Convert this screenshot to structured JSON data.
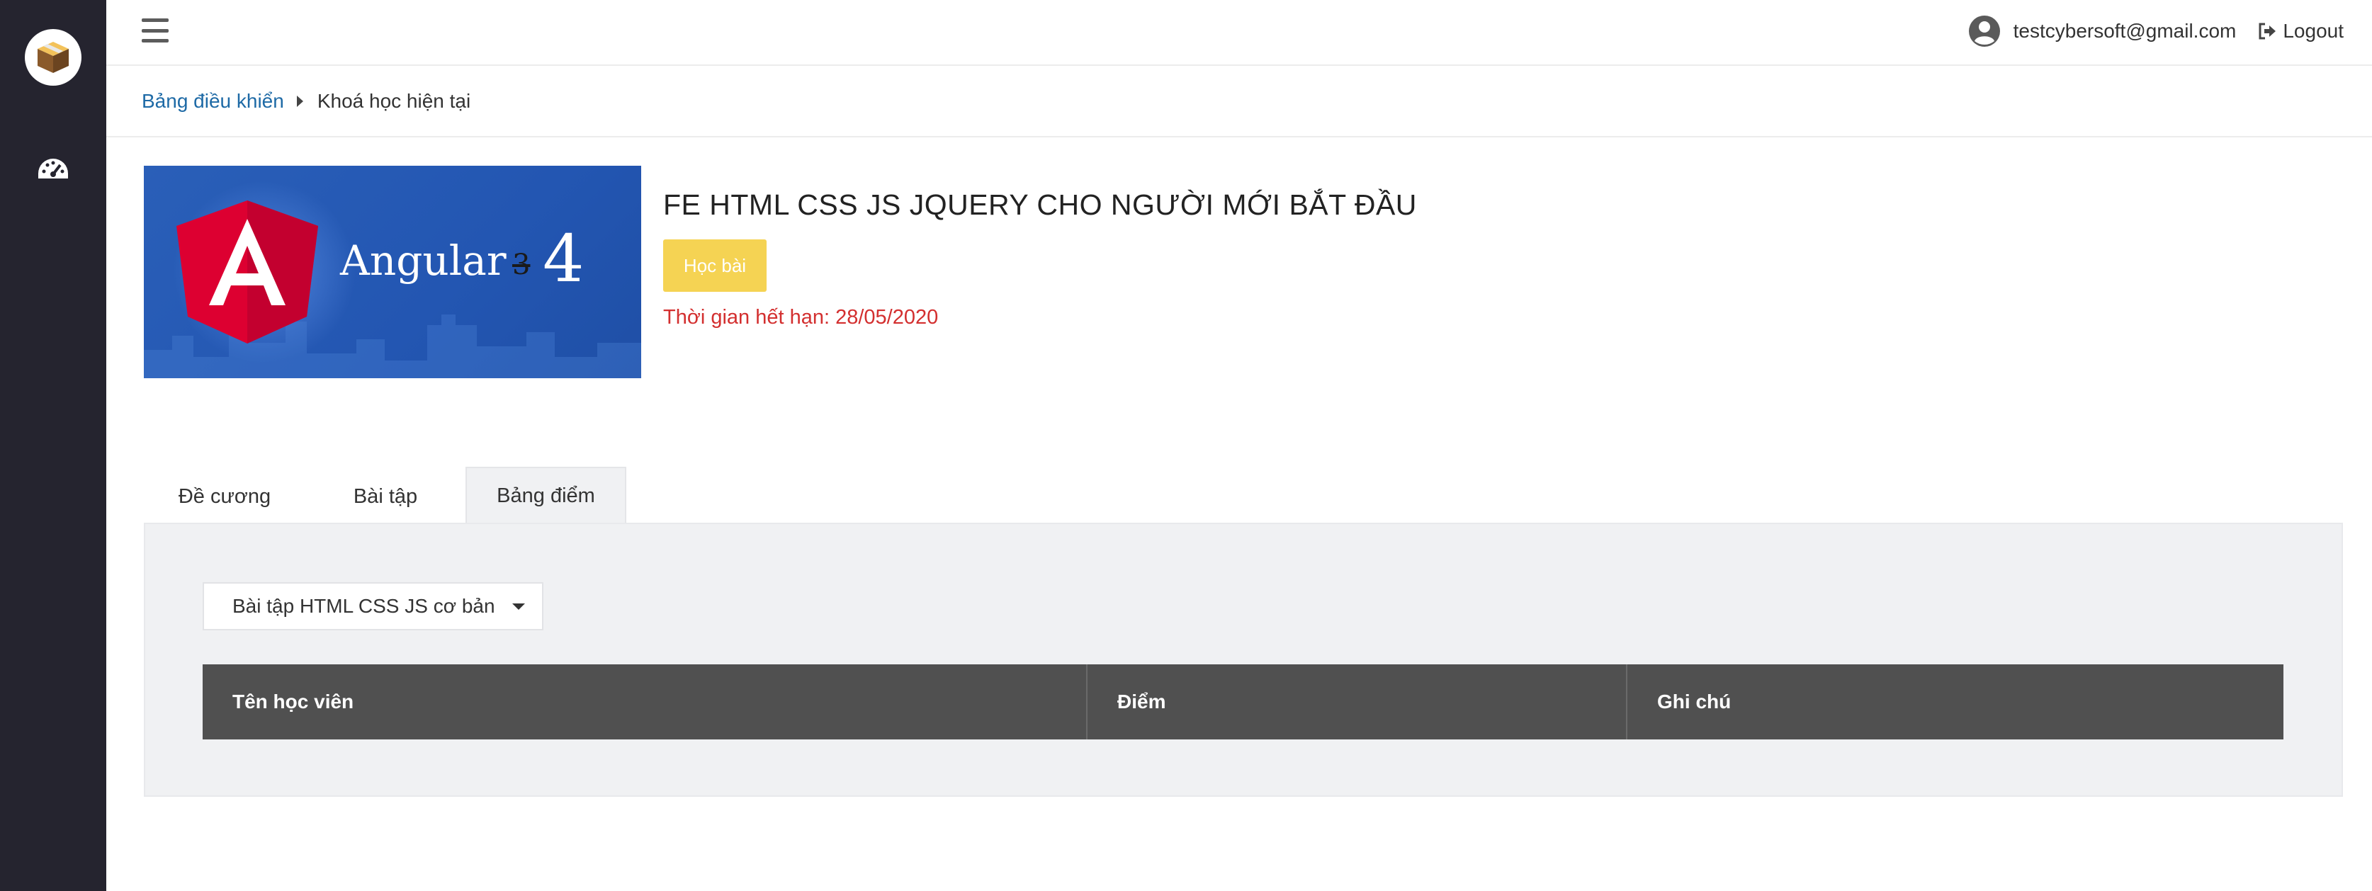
{
  "topbar": {
    "user_email": "testcybersoft@gmail.com",
    "logout_label": "Logout"
  },
  "breadcrumb": {
    "home": "Bảng điều khiển",
    "current": "Khoá học hiện tại"
  },
  "course": {
    "image_caption": "Angular",
    "image_version_old": "3",
    "image_version_new": "4",
    "title": "FE HTML CSS JS JQUERY CHO NGƯỜI MỚI BẮT ĐẦU",
    "study_button": "Học bài",
    "expiry": "Thời gian hết hạn: 28/05/2020"
  },
  "tabs": [
    {
      "label": "Đề cương"
    },
    {
      "label": "Bài tập"
    },
    {
      "label": "Bảng điểm"
    }
  ],
  "panel": {
    "selected_exercise": "Bài tập HTML CSS JS cơ bản",
    "table_headers": [
      "Tên học viên",
      "Điểm",
      "Ghi chú"
    ]
  },
  "colors": {
    "sidebar": "#25242f",
    "link": "#1e6aa6",
    "study_button": "#f5d353",
    "expiry": "#d32f2f",
    "table_header": "#505050"
  }
}
